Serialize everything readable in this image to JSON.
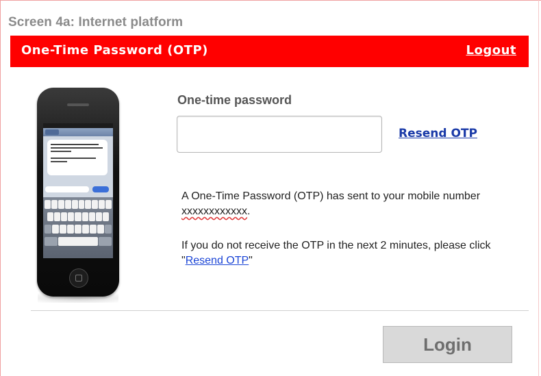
{
  "caption": "Screen 4a: Internet platform",
  "header": {
    "title": "One-Time Password (OTP)",
    "logout_label": "Logout",
    "background_color": "#ff0000"
  },
  "form": {
    "otp_label": "One-time password",
    "otp_value": "",
    "resend_label": "Resend OTP"
  },
  "info": {
    "sent_text": "A One-Time Password (OTP) has sent to your mobile number ",
    "masked_number": "xxxxxxxxxxxx",
    "sent_suffix": ".",
    "retry_text": "If you do not receive the OTP in the next 2 minutes, please click \"",
    "retry_link": "Resend OTP",
    "retry_suffix": "\""
  },
  "actions": {
    "login_label": "Login"
  },
  "icons": {
    "phone": "smartphone-sms-illustration"
  }
}
